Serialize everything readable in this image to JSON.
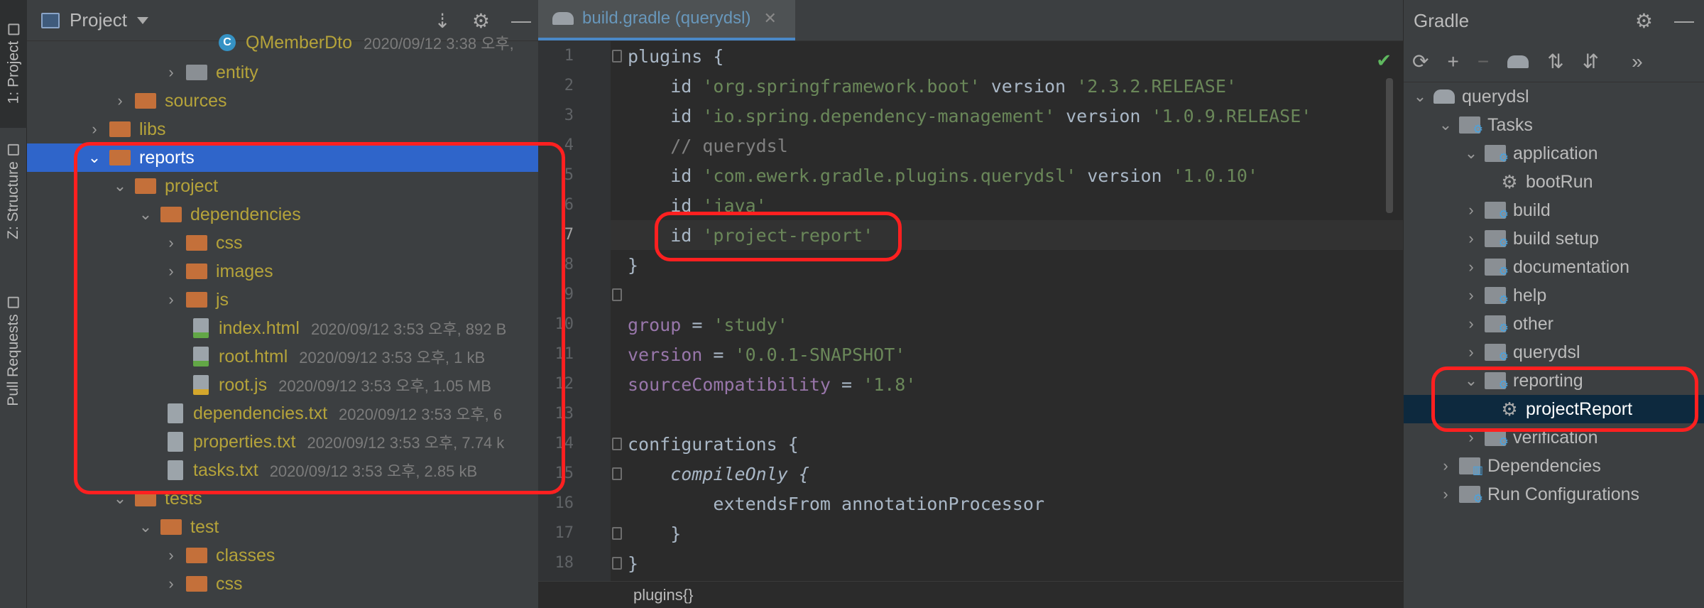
{
  "stripe": {
    "tabs": [
      {
        "label": "1: Project"
      },
      {
        "label": "Z: Structure"
      },
      {
        "label": "Pull Requests"
      }
    ]
  },
  "project_panel": {
    "title": "Project",
    "tree": [
      {
        "name": "QMemberDto",
        "meta": "2020/09/12 3:38 오후,",
        "kind": "class"
      },
      {
        "name": "entity",
        "kind": "package"
      },
      {
        "name": "sources",
        "kind": "folder"
      },
      {
        "name": "libs",
        "kind": "folder"
      },
      {
        "name": "reports",
        "kind": "folder"
      },
      {
        "name": "project",
        "kind": "folder"
      },
      {
        "name": "dependencies",
        "kind": "folder"
      },
      {
        "name": "css",
        "kind": "folder"
      },
      {
        "name": "images",
        "kind": "folder"
      },
      {
        "name": "js",
        "kind": "folder"
      },
      {
        "name": "index.html",
        "meta": "2020/09/12 3:53 오후, 892 B",
        "kind": "html"
      },
      {
        "name": "root.html",
        "meta": "2020/09/12 3:53 오후, 1 kB",
        "kind": "html"
      },
      {
        "name": "root.js",
        "meta": "2020/09/12 3:53 오후, 1.05 MB",
        "kind": "js"
      },
      {
        "name": "dependencies.txt",
        "meta": "2020/09/12 3:53 오후, 6",
        "kind": "txt"
      },
      {
        "name": "properties.txt",
        "meta": "2020/09/12 3:53 오후, 7.74 k",
        "kind": "txt"
      },
      {
        "name": "tasks.txt",
        "meta": "2020/09/12 3:53 오후, 2.85 kB",
        "kind": "txt"
      },
      {
        "name": "tests",
        "kind": "folder"
      },
      {
        "name": "test",
        "kind": "folder"
      },
      {
        "name": "classes",
        "kind": "folder"
      },
      {
        "name": "css",
        "kind": "folder"
      }
    ]
  },
  "editor": {
    "tab_label": "build.gradle (querydsl)",
    "line_numbers": [
      "1",
      "2",
      "3",
      "4",
      "5",
      "6",
      "7",
      "8",
      "9",
      "10",
      "11",
      "12",
      "13",
      "14",
      "15",
      "16",
      "17",
      "18"
    ],
    "lines": {
      "l1_a": "plugins {",
      "l2_a": "    id ",
      "l2_b": "'org.springframework.boot'",
      "l2_c": " version ",
      "l2_d": "'2.3.2.RELEASE'",
      "l3_a": "    id ",
      "l3_b": "'io.spring.dependency-management'",
      "l3_c": " version ",
      "l3_d": "'1.0.9.RELEASE'",
      "l4_a": "    // querydsl",
      "l5_a": "    id ",
      "l5_b": "'com.ewerk.gradle.plugins.querydsl'",
      "l5_c": " version ",
      "l5_d": "'1.0.10'",
      "l6_a": "    id ",
      "l6_b": "'java'",
      "l7_a": "    id ",
      "l7_b": "'project-report'",
      "l8_a": "}",
      "l10_a": "group",
      "l10_b": " = ",
      "l10_c": "'study'",
      "l11_a": "version",
      "l11_b": " = ",
      "l11_c": "'0.0.1-SNAPSHOT'",
      "l12_a": "sourceCompatibility",
      "l12_b": " = ",
      "l12_c": "'1.8'",
      "l14_a": "configurations {",
      "l15_a": "    compileOnly {",
      "l16_a": "        extendsFrom annotationProcessor",
      "l17_a": "    }",
      "l18_a": "}"
    },
    "breadcrumb": "plugins{}"
  },
  "gradle_panel": {
    "title": "Gradle",
    "tree": [
      {
        "name": "querydsl",
        "kind": "project"
      },
      {
        "name": "Tasks",
        "kind": "taskfolder"
      },
      {
        "name": "application",
        "kind": "taskfolder"
      },
      {
        "name": "bootRun",
        "kind": "task"
      },
      {
        "name": "build",
        "kind": "taskfolder"
      },
      {
        "name": "build setup",
        "kind": "taskfolder"
      },
      {
        "name": "documentation",
        "kind": "taskfolder"
      },
      {
        "name": "help",
        "kind": "taskfolder"
      },
      {
        "name": "other",
        "kind": "taskfolder"
      },
      {
        "name": "querydsl",
        "kind": "taskfolder"
      },
      {
        "name": "reporting",
        "kind": "taskfolder"
      },
      {
        "name": "projectReport",
        "kind": "task"
      },
      {
        "name": "verification",
        "kind": "taskfolder"
      },
      {
        "name": "Dependencies",
        "kind": "deps"
      },
      {
        "name": "Run Configurations",
        "kind": "runconf"
      }
    ]
  },
  "colors": {
    "annotation_red": "#ff2020",
    "selection_blue": "#2f65ca"
  }
}
